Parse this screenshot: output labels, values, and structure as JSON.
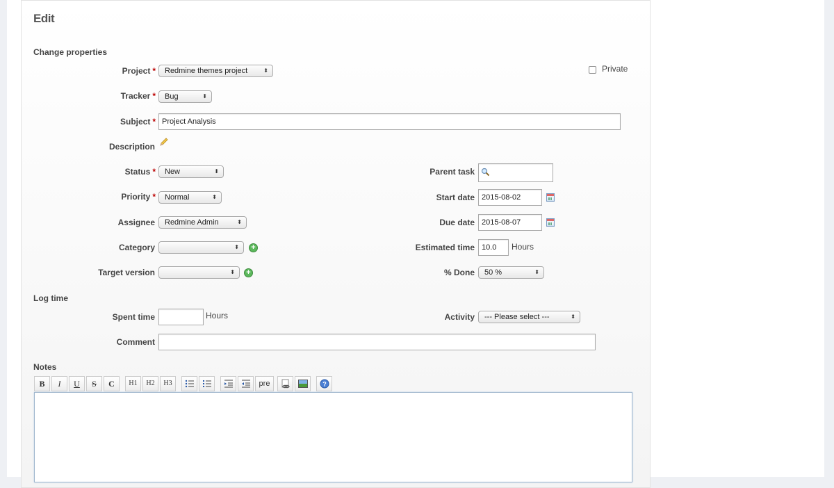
{
  "heading": "Edit",
  "sections": {
    "change_properties": "Change properties",
    "log_time": "Log time",
    "notes": "Notes"
  },
  "required_mark": "*",
  "fields": {
    "project": {
      "label": "Project",
      "value": "Redmine themes project"
    },
    "private": {
      "label": "Private",
      "checked": false
    },
    "tracker": {
      "label": "Tracker",
      "value": "Bug"
    },
    "subject": {
      "label": "Subject",
      "value": "Project Analysis"
    },
    "description": {
      "label": "Description"
    },
    "status": {
      "label": "Status",
      "value": "New"
    },
    "priority": {
      "label": "Priority",
      "value": "Normal"
    },
    "assignee": {
      "label": "Assignee",
      "value": "Redmine Admin"
    },
    "category": {
      "label": "Category",
      "value": ""
    },
    "target_version": {
      "label": "Target version",
      "value": ""
    },
    "parent_task": {
      "label": "Parent task",
      "value": ""
    },
    "start_date": {
      "label": "Start date",
      "value": "2015-08-02"
    },
    "due_date": {
      "label": "Due date",
      "value": "2015-08-07"
    },
    "estimated_time": {
      "label": "Estimated time",
      "value": "10.0",
      "unit": "Hours"
    },
    "done_ratio": {
      "label": "% Done",
      "value": "50 %"
    },
    "spent_time": {
      "label": "Spent time",
      "value": "",
      "unit": "Hours"
    },
    "activity": {
      "label": "Activity",
      "value": "--- Please select ---"
    },
    "comment": {
      "label": "Comment",
      "value": ""
    }
  },
  "toolbar": {
    "bold": "B",
    "italic": "I",
    "underline": "U",
    "strike": "S",
    "code": "C",
    "h1": "H1",
    "h2": "H2",
    "h3": "H3",
    "pre": "pre"
  },
  "icons": {
    "edit_description": "pencil-icon",
    "search": "magnifier-icon",
    "calendar": "calendar-icon",
    "add": "plus-icon",
    "help": "help-icon"
  },
  "colors": {
    "required": "#bb0000",
    "add_button": "#5cb85c",
    "textarea_focus": "#9fb6cd"
  }
}
